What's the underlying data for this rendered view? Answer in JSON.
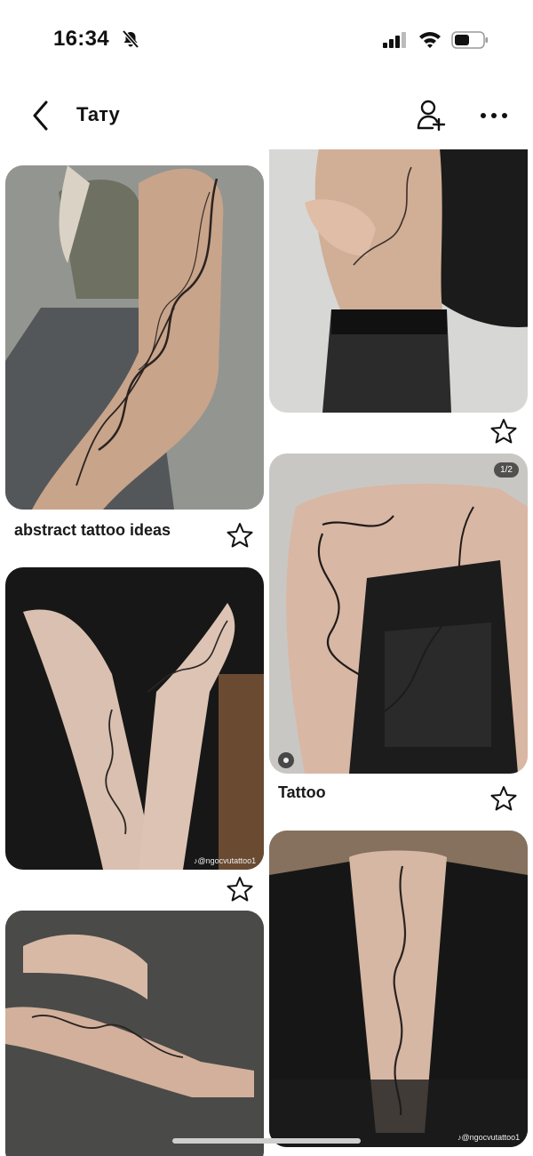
{
  "status": {
    "time": "16:34"
  },
  "header": {
    "title": "Тату"
  },
  "pins": [
    {
      "caption": "abstract tattoo ideas"
    },
    {
      "caption": ""
    },
    {
      "caption": ""
    },
    {
      "caption": "Tattoo",
      "badge": "1/2"
    },
    {
      "caption": "",
      "watermark": "♪@ngocvutattoo1"
    },
    {
      "caption": ""
    },
    {
      "caption": "",
      "watermark": "♪@ngocvutattoo1"
    }
  ]
}
